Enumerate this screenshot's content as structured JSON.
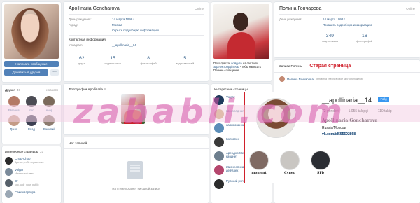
{
  "left": {
    "buttons": {
      "message": "Написать сообщение",
      "add_friend": "Добавить в друзья",
      "more": "..."
    },
    "friends": {
      "title": "Друзья",
      "count": "40",
      "right": "новости",
      "items": [
        {
          "name": "Евгения",
          "color": "#b47a66"
        },
        {
          "name": "Iron",
          "color": "#4c4c54"
        },
        {
          "name": "Анар",
          "color": "#7b6a5b"
        },
        {
          "name": "Даша",
          "color": "#c49b86"
        },
        {
          "name": "Влад",
          "color": "#3c3f52"
        },
        {
          "name": "Василий",
          "color": "#8d7c70"
        }
      ]
    },
    "pages": {
      "title": "Интересные страницы",
      "count": "21",
      "items": [
        {
          "title": "Chop-Chop",
          "sub": "Бритье, тебе справочник",
          "color": "#2b2b2b"
        },
        {
          "title": "Volgar",
          "sub": "Маленький свет",
          "color": "#7a8a9a"
        },
        {
          "title": "Dr",
          "sub": "kdo.ru/dr_your_public",
          "color": "#56606a"
        },
        {
          "title": "Самоквартира",
          "sub": "",
          "color": "#9aa7b4"
        }
      ]
    }
  },
  "center": {
    "name": "Apollinaria Goncharova",
    "online": "Online",
    "info": [
      {
        "label": "День рождения:",
        "value": "14 марта 1998 г."
      },
      {
        "label": "Город:",
        "value": "Москва"
      }
    ],
    "toggle": "Скрыть подробную информацию",
    "contacts_title": "Контактная информация",
    "contacts": [
      {
        "label": "Instagram:",
        "value": "__apollinaria__14"
      }
    ],
    "counters": [
      {
        "num": "62",
        "label": "друга"
      },
      {
        "num": "15",
        "label": "подписчиков"
      },
      {
        "num": "8",
        "label": "фотографий"
      },
      {
        "num": "5",
        "label": "видеозаписей"
      }
    ],
    "photos_title": "Фотографии Apollinaria",
    "photos_count": "8",
    "wall_tab": "Нет записей",
    "wall_empty": "На стене пока нет ни одной записи"
  },
  "side": {
    "note_pre": "Пожалуйста, ",
    "note_link": "войдите",
    "note_mid": " на сайт или ",
    "note_link2": "зарегистрируйтесь",
    "note_post": ", чтобы написать Полине сообщение.",
    "ipages_title": "Интересные страницы",
    "ipages": [
      {
        "title": "Volgar",
        "color": "#1f3a5c"
      },
      {
        "title": "Шоколадная фабрика",
        "color": "#c9a56a"
      },
      {
        "title": "нарисованная девочка",
        "color": "#5b8db8"
      },
      {
        "title": "Колготки",
        "color": "#3a3a3a"
      },
      {
        "title": "Арендно-Методический кабинет",
        "color": "#6e7f8e"
      },
      {
        "title": "Жизнеописание лучших девушек",
        "color": "#b5466d"
      },
      {
        "title": "Русский рэп",
        "color": "#2c2c2c"
      }
    ]
  },
  "right": {
    "name": "Полина Гончарова",
    "online": "Online",
    "info": [
      {
        "label": "День рождения:",
        "value": "14 марта 1998 г."
      }
    ],
    "toggle": "Показать подробную информацию",
    "counters": [
      {
        "num": "349",
        "label": "подписчиков"
      },
      {
        "num": "16",
        "label": "фотографий"
      }
    ],
    "tabs": {
      "wall": "Записи Полины",
      "red": "Старая страница"
    },
    "post": {
      "name": "Полина Гончарова",
      "sub": "обновила статус в свое местоположение"
    }
  },
  "instagram": {
    "username": "__apollinaria__14",
    "follow": "Follg",
    "stats": [
      "72 gönderi",
      "1.055 takipçi",
      "110 takip"
    ],
    "full_name": "Apollinaria Goncharova",
    "bio": "Russia/Moscow",
    "link": "vk.com/id555502868",
    "highlights": [
      {
        "label": "moment",
        "color": "#7f6a63"
      },
      {
        "label": "Супер",
        "color": "#c9c6c2"
      },
      {
        "label": "SPb",
        "color": "#2b2d33"
      }
    ]
  },
  "watermark": "zababli.com",
  "colors": {
    "vk_blue": "#5181b8",
    "link": "#2a5885",
    "accent_red": "#d0202b",
    "ig_blue": "#3897f0"
  }
}
